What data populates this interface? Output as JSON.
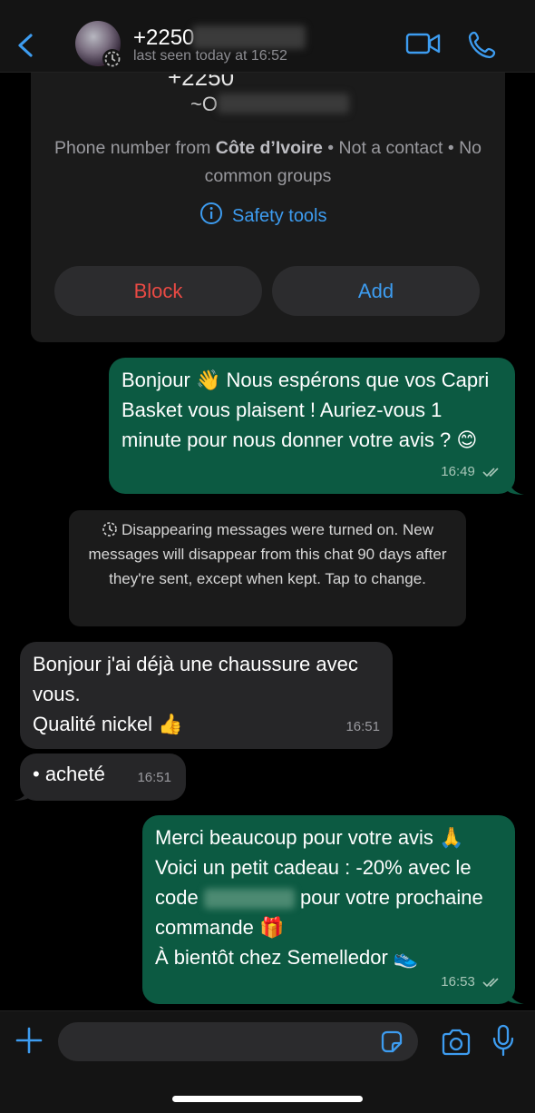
{
  "header": {
    "contact_name": "+2250",
    "last_seen": "last seen today at 16:52"
  },
  "card": {
    "number_partial": "+2250",
    "alias": "~O",
    "info_prefix": "Phone number from ",
    "country": "Côte d’Ivoire",
    "info_suffix": " • Not a contact • No common groups",
    "safety_label": "Safety tools",
    "block_label": "Block",
    "add_label": "Add"
  },
  "messages": [
    {
      "text": "Bonjour 👋 Nous espérons que vos Capri Basket vous plaisent ! Auriez-vous 1 minute pour nous donner votre avis ? 😊",
      "time": "16:49"
    },
    {
      "text_line1": "Bonjour j'ai déjà une chaussure avec vous.",
      "text_line2": "Qualité nickel 👍",
      "time": "16:51"
    },
    {
      "text": "• acheté",
      "time": "16:51"
    },
    {
      "line1": "Merci beaucoup pour votre avis 🙏",
      "line2": "Voici un petit cadeau : -20% avec le",
      "line3_prefix": "code",
      "line3_suffix": "pour votre prochaine",
      "line4": "commande 🎁",
      "line5": "À bientôt chez Semelledor 👟",
      "time": "16:53"
    }
  ],
  "notice": "Disappearing messages were turned on. New messages will disappear from this chat 90 days after they're sent, except when kept. Tap to change.",
  "colors": {
    "accent": "#3d9cf0",
    "danger": "#ea4a44",
    "outgoing_bubble": "#0c5a42",
    "incoming_bubble": "#262628"
  },
  "icons": [
    "chevron-left-icon",
    "video-camera-icon",
    "phone-icon",
    "info-circle-icon",
    "timer-icon",
    "plus-icon",
    "sticker-icon",
    "camera-icon",
    "microphone-icon"
  ]
}
